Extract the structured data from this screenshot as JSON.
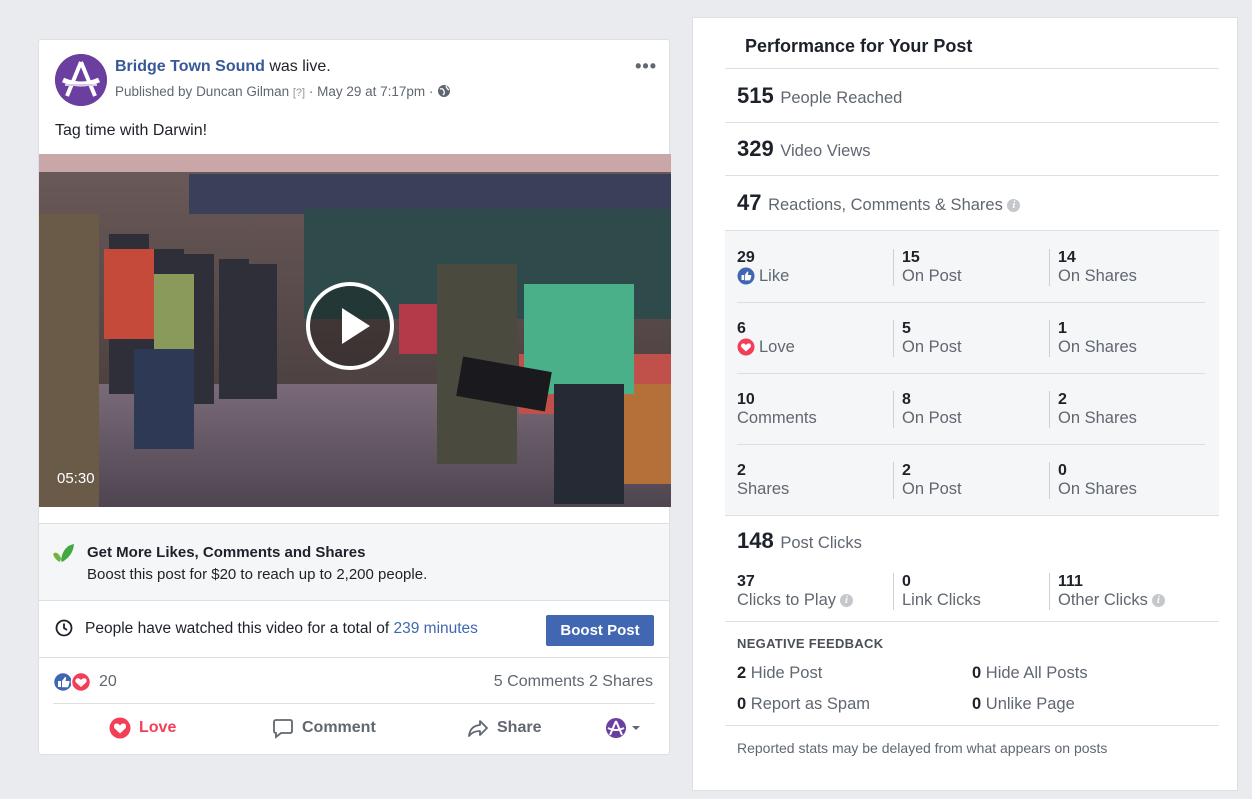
{
  "post": {
    "page_name": "Bridge Town Sound",
    "status_suffix": " was live.",
    "published_prefix": "Published by ",
    "publisher": "Duncan Gilman",
    "help_marker": "[?]",
    "timestamp": "May 29 at 7:17pm",
    "separator": " · ",
    "text": "Tag time with Darwin!",
    "video_duration": "05:30",
    "more_label": "•••",
    "promo": {
      "title": "Get More Likes, Comments and Shares",
      "subtitle": "Boost this post for $20 to reach up to 2,200 people."
    },
    "watch": {
      "text": "People have watched this video for a total of ",
      "minutes": "239 minutes",
      "boost_button": "Boost Post"
    },
    "reactions": {
      "count": "20",
      "comments": "5 Comments",
      "shares": "2 Shares"
    },
    "actions": {
      "love": "Love",
      "comment": "Comment",
      "share": "Share"
    },
    "colors": {
      "brand_blue": "#4267b2",
      "link_blue": "#385898",
      "love_red": "#f33e58",
      "avatar_purple": "#6b3fa0"
    }
  },
  "performance": {
    "title": "Performance for Your Post",
    "reached": {
      "num": "515",
      "label": "People Reached"
    },
    "views": {
      "num": "329",
      "label": "Video Views"
    },
    "engagement": {
      "num": "47",
      "label": "Reactions, Comments & Shares"
    },
    "rows": [
      {
        "value": "29",
        "label": "Like",
        "icon": "like-icon",
        "post": "15",
        "post_label": "On Post",
        "shares": "14",
        "shares_label": "On Shares"
      },
      {
        "value": "6",
        "label": "Love",
        "icon": "love-icon",
        "post": "5",
        "post_label": "On Post",
        "shares": "1",
        "shares_label": "On Shares"
      },
      {
        "value": "10",
        "label": "Comments",
        "post": "8",
        "post_label": "On Post",
        "shares": "2",
        "shares_label": "On Shares"
      },
      {
        "value": "2",
        "label": "Shares",
        "post": "2",
        "post_label": "On Post",
        "shares": "0",
        "shares_label": "On Shares"
      }
    ],
    "clicks": {
      "num": "148",
      "label": "Post Clicks"
    },
    "click_breakdown": [
      {
        "value": "37",
        "label": "Clicks to Play"
      },
      {
        "value": "0",
        "label": "Link Clicks"
      },
      {
        "value": "111",
        "label": "Other Clicks"
      }
    ],
    "negative": {
      "title": "NEGATIVE FEEDBACK",
      "hide_post": {
        "n": "2",
        "label": " Hide Post"
      },
      "hide_all": {
        "n": "0",
        "label": " Hide All Posts"
      },
      "spam": {
        "n": "0",
        "label": " Report as Spam"
      },
      "unlike": {
        "n": "0",
        "label": " Unlike Page"
      }
    },
    "footnote": "Reported stats may be delayed from what appears on posts"
  }
}
